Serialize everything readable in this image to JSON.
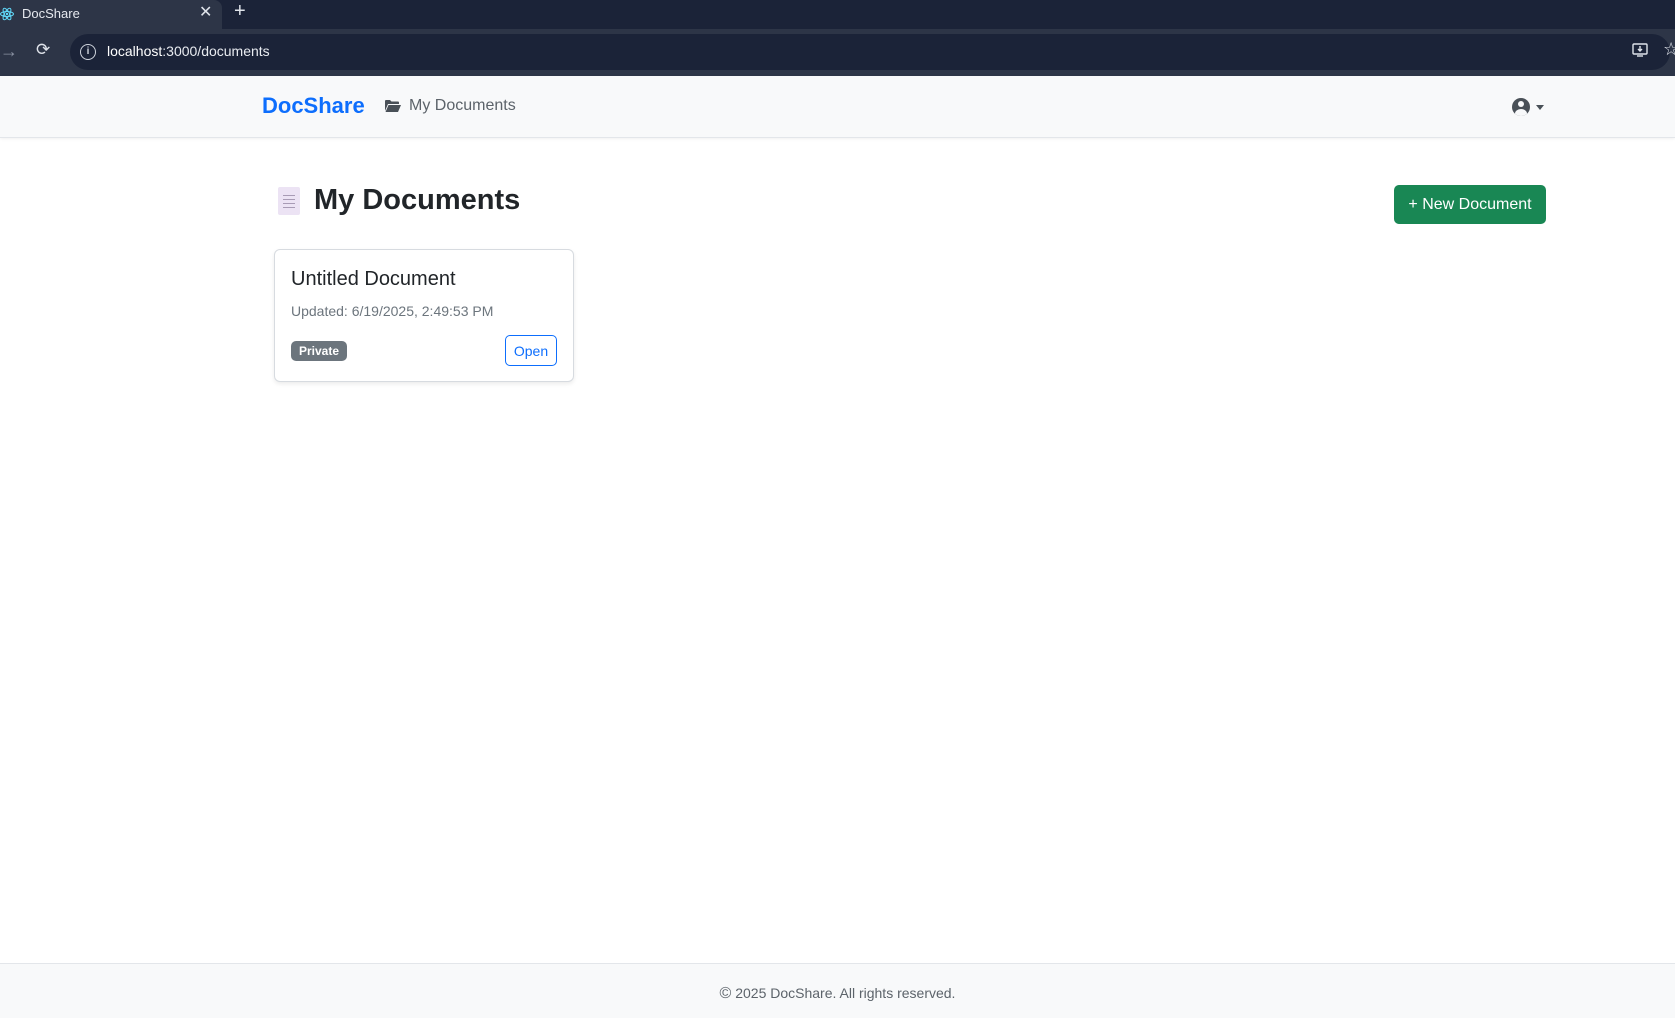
{
  "browser": {
    "tab_title": "DocShare",
    "tab_close": "✕",
    "new_tab": "+",
    "url_host": "localhost",
    "url_path": ":3000/documents"
  },
  "navbar": {
    "brand": "DocShare",
    "nav_link_label": "My Documents"
  },
  "main": {
    "page_title": "My Documents",
    "new_document_label": "+ New Document",
    "documents": [
      {
        "title": "Untitled Document",
        "updated": "Updated: 6/19/2025, 2:49:53 PM",
        "visibility": "Private",
        "open_label": "Open"
      }
    ]
  },
  "footer": {
    "copyright_symbol": "©",
    "text": "2025 DocShare. All rights reserved."
  },
  "colors": {
    "brand": "#0d6efd",
    "success": "#198754",
    "badge_secondary": "#6c757d"
  }
}
